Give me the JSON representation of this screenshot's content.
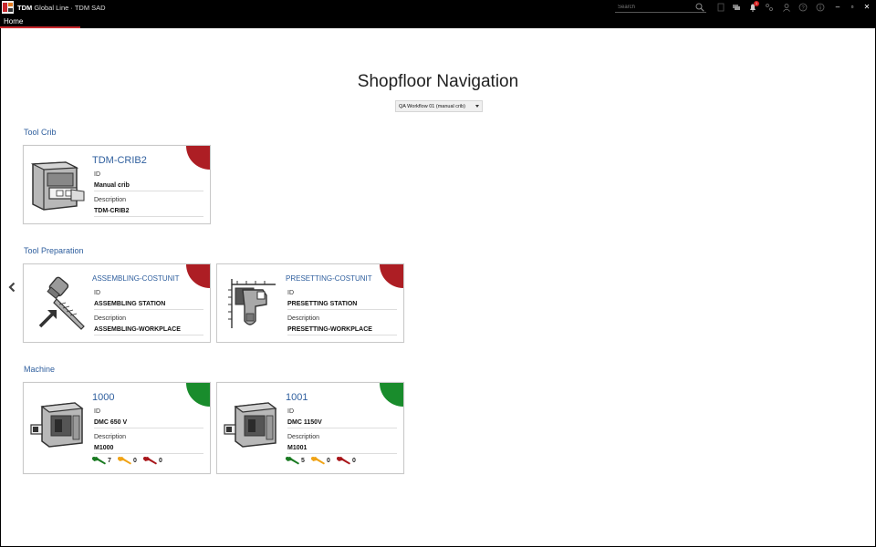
{
  "window": {
    "app_name": "TDM",
    "app_title": "Global Line · TDM SAD",
    "search_placeholder": "Search",
    "notification_count": "1",
    "minimize": "–",
    "maximize": "▫",
    "close": "✕"
  },
  "nav": {
    "home": "Home"
  },
  "page": {
    "title": "Shopfloor Navigation",
    "workflow_selected": "QA Workflow 01 (manual crib)"
  },
  "sections": {
    "tool_crib": "Tool Crib",
    "tool_preparation": "Tool Preparation",
    "machine": "Machine"
  },
  "labels": {
    "id": "ID",
    "description": "Description"
  },
  "cards": {
    "crib2": {
      "title": "TDM-CRIB2",
      "id": "Manual crib",
      "description": "TDM-CRIB2",
      "status": "red"
    },
    "assembling": {
      "title": "ASSEMBLING-COSTUNIT",
      "id": "ASSEMBLING STATION",
      "description": "ASSEMBLING-WORKPLACE",
      "status": "red"
    },
    "presetting": {
      "title": "PRESETTING-COSTUNIT",
      "id": "PRESETTING STATION",
      "description": "PRESETTING-WORKPLACE",
      "status": "red"
    },
    "m1000": {
      "title": "1000",
      "id": "DMC 650 V",
      "description": "M1000",
      "status": "green",
      "green_count": "7",
      "yellow_count": "0",
      "red_count": "0"
    },
    "m1001": {
      "title": "1001",
      "id": "DMC 1150V",
      "description": "M1001",
      "status": "green",
      "green_count": "5",
      "yellow_count": "0",
      "red_count": "0"
    }
  },
  "colors": {
    "accent_blue": "#2f5f9e",
    "status_red": "#ad1e24",
    "status_green": "#198c2c",
    "tool_green": "#1a7a22",
    "tool_yellow": "#f0a316",
    "tool_red": "#a8161a"
  }
}
